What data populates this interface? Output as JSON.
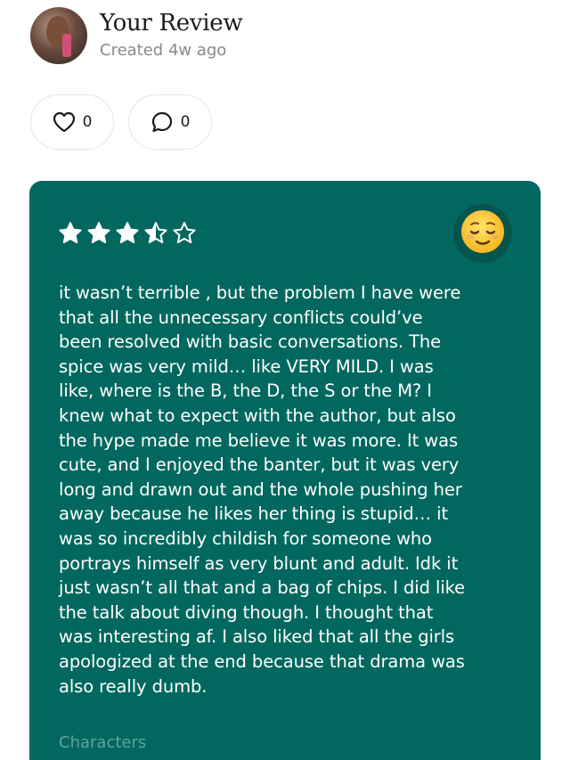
{
  "header": {
    "title": "Your Review",
    "created": "Created 4w ago"
  },
  "reactions": {
    "likes": "0",
    "comments": "0"
  },
  "review": {
    "rating": 3.5,
    "max_rating": 5,
    "mood_icon": "relieved-face-emoji",
    "text": "it wasn’t terrible , but the problem I have were\nthat all the unnecessary conflicts could’ve\nbeen resolved with basic conversations. The\nspice was very mild… like VERY MILD. I was\nlike, where is the B, the D, the S or the M? I\nknew what to expect with the author, but also\nthe hype made me believe it was more. It was\ncute, and I enjoyed the banter, but it was very\nlong and drawn out and the whole pushing her\naway because he likes her thing is stupid… it\nwas so incredibly childish for someone who\nportrays himself as very blunt and adult. Idk it\njust wasn’t all that and a bag of chips. I did like\nthe talk about diving though. I thought that\nwas interesting af. I also liked that all the girls\napologized at the end because that drama was\nalso really dumb.",
    "next_section": "Characters"
  },
  "colors": {
    "card_bg": "#02685f",
    "badge_bg": "#06544d",
    "muted_label": "#5fa39b"
  }
}
